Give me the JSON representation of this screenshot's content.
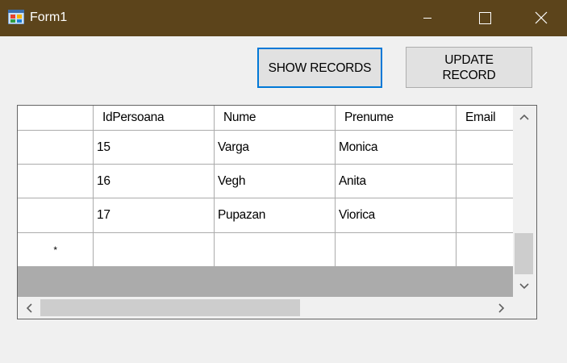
{
  "window": {
    "title": "Form1",
    "titlebar_color": "#5c441b",
    "icons": [
      "app-icon",
      "minimize-icon",
      "maximize-icon",
      "close-icon"
    ]
  },
  "toolbar": {
    "show_records_label": "SHOW RECORDS",
    "update_record_label": "UPDATE\nRECORD",
    "focused_button_color": "#0078d7"
  },
  "grid": {
    "columns": [
      "IdPersoana",
      "Nume",
      "Prenume",
      "Email"
    ],
    "rows": [
      [
        "15",
        "Varga",
        "Monica",
        ""
      ],
      [
        "16",
        "Vegh",
        "Anita",
        ""
      ],
      [
        "17",
        "Pupazan",
        "Viorica",
        ""
      ]
    ],
    "new_row_marker": "*",
    "scroll_icons": [
      "chevron-up-icon",
      "chevron-down-icon",
      "chevron-left-icon",
      "chevron-right-icon"
    ]
  }
}
